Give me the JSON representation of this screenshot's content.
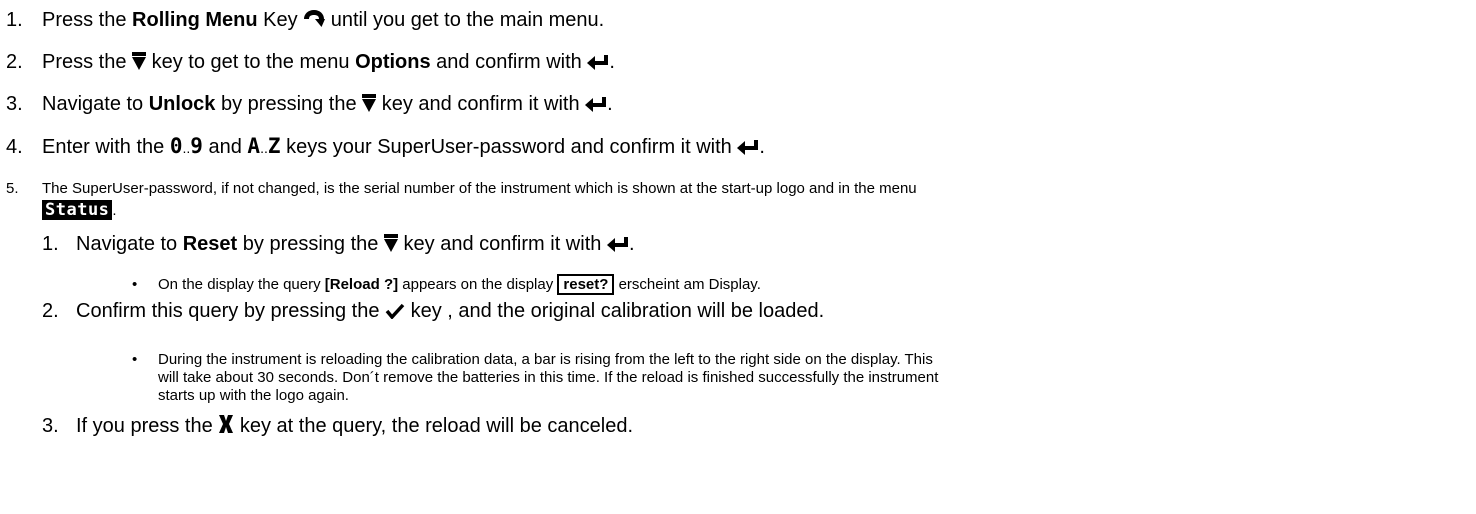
{
  "steps": [
    {
      "num": "1.",
      "pre": "Press the ",
      "bold": "Rolling Menu",
      "post": " Key ",
      "post2": " until you get to the main menu."
    },
    {
      "num": "2.",
      "pre": "Press the ",
      "mid": " key to get to the menu ",
      "bold": "Options",
      "post": " and confirm with ",
      "end": "."
    },
    {
      "num": "3.",
      "pre": "Navigate to ",
      "bold": "Unlock",
      "mid": " by pressing the ",
      "post": " key and confirm it with ",
      "end": "."
    },
    {
      "num": "4.",
      "pre": "Enter with the ",
      "seg1": "0",
      "dots": "..",
      "seg2": "9",
      "and": " and ",
      "seg3": "A",
      "dots2": "..",
      "seg4": "Z",
      "post": " keys your SuperUser-password and confirm it with ",
      "end": "."
    },
    {
      "num": "5.",
      "text": "The SuperUser-password, if not changed, is the serial number of the instrument which is shown at the start-up logo and in the menu",
      "lcd": "Status",
      "end": "."
    }
  ],
  "substeps": [
    {
      "num": "1.",
      "pre": "Navigate to ",
      "bold": "Reset",
      "mid": " by pressing the ",
      "post": " key and confirm it with ",
      "end": "."
    },
    {
      "num": "2.",
      "pre": "Confirm this query by pressing the ",
      "post": " key , and the original calibration will be loaded."
    },
    {
      "num": "3.",
      "pre": "If you press the ",
      "post": " key at the query, the reload will be canceled."
    }
  ],
  "bullets": [
    {
      "pre": "On the display the query ",
      "bold": "[Reload ?]",
      "mid": " appears on the display ",
      "box": "reset?",
      "post": " erscheint am Display."
    },
    {
      "lines": [
        "During the instrument is reloading the calibration data, a bar is rising from the left to the right side on the display. This",
        "will take about 30 seconds. Don´t remove the batteries in this time. If the reload is finished successfully the instrument",
        "starts up with the logo again."
      ]
    }
  ],
  "icons": {
    "rolling": "rolling-menu-icon",
    "down": "down-arrow-icon",
    "enter": "enter-icon",
    "check": "checkmark-icon",
    "cancel": "cancel-x-icon"
  },
  "bullet_char": "•"
}
